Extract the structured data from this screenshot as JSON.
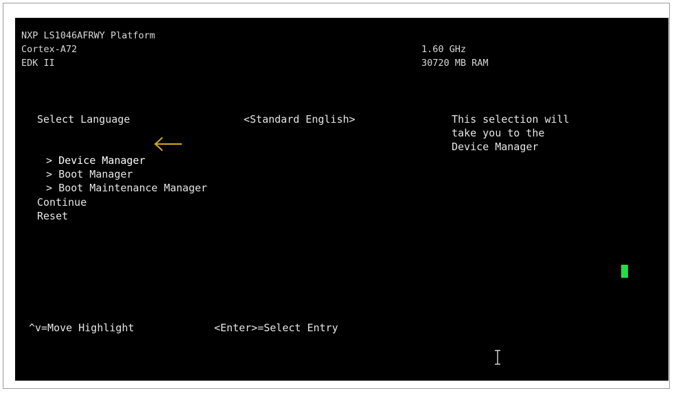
{
  "system_info": {
    "platform": "NXP LS1046AFRWY Platform",
    "cpu": "Cortex-A72",
    "firmware": "EDK II",
    "cpu_speed": "1.60 GHz",
    "memory": "30720 MB RAM"
  },
  "language": {
    "label": "Select Language",
    "value": "<Standard English>"
  },
  "menu": {
    "items": [
      {
        "prefix": ">",
        "label": "Device Manager",
        "selected": true
      },
      {
        "prefix": ">",
        "label": "Boot Manager",
        "selected": false
      },
      {
        "prefix": ">",
        "label": "Boot Maintenance Manager",
        "selected": false
      }
    ],
    "actions": [
      {
        "label": "Continue"
      },
      {
        "label": "Reset"
      }
    ]
  },
  "help": {
    "lines": [
      "This selection will",
      "take you to the",
      "Device Manager"
    ]
  },
  "footer": {
    "move_hint": "^v=Move Highlight",
    "select_hint": "<Enter>=Select Entry"
  },
  "colors": {
    "background": "#000000",
    "text": "#e6e6e6",
    "annotation_arrow": "#c9a227",
    "cursor": "#22dd44"
  },
  "icons": {
    "annotation": "left-arrow-icon",
    "text_cursor": "ibeam-cursor-icon",
    "block_cursor": "block-cursor-icon"
  }
}
